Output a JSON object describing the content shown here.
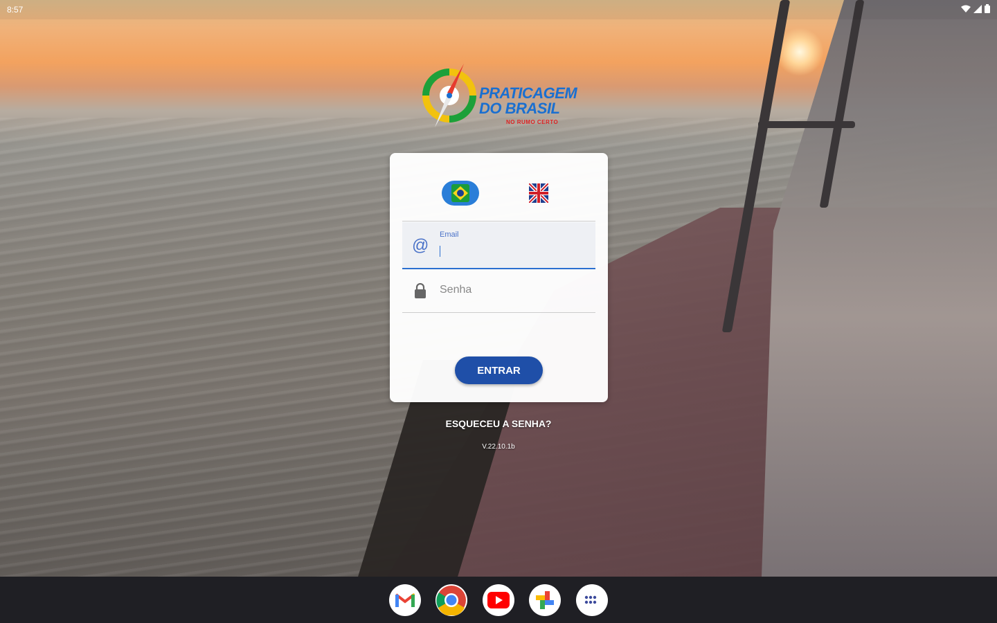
{
  "status_bar": {
    "time": "8:57",
    "icons": [
      "wifi-icon",
      "signal-icon",
      "battery-icon"
    ]
  },
  "logo": {
    "brand_line1": "PRATICAGEM",
    "brand_line2": "DO BRASIL",
    "tagline": "NO RUMO CERTO"
  },
  "language": {
    "options": [
      {
        "name": "pt-BR",
        "icon": "brazil-flag-icon",
        "selected": true
      },
      {
        "name": "en",
        "icon": "uk-flag-icon",
        "selected": false
      }
    ]
  },
  "form": {
    "email_label": "Email",
    "email_value": "",
    "password_placeholder": "Senha",
    "submit_label": "ENTRAR"
  },
  "footer": {
    "forgot_password": "ESQUECEU A SENHA?",
    "version": "V.22.10.1b"
  },
  "dock": {
    "apps": [
      "gmail-icon",
      "chrome-icon",
      "youtube-icon",
      "photos-icon",
      "app-launcher-icon"
    ]
  },
  "colors": {
    "primary": "#1f4fa8",
    "accent": "#2a7ed8",
    "taskbar": "#1f1f24"
  }
}
